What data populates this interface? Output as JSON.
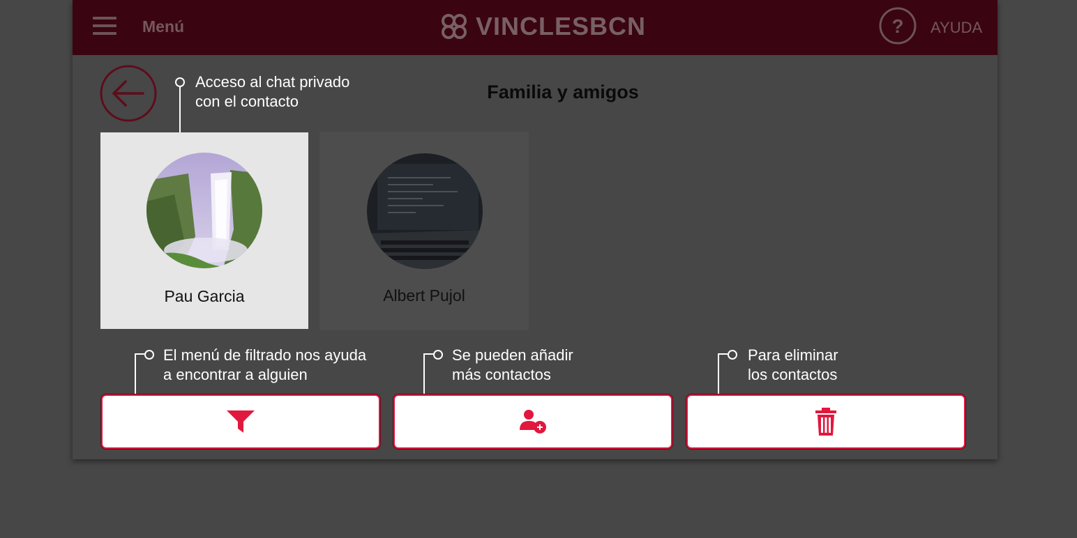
{
  "header": {
    "menu_label": "Menú",
    "logo_text": "VINCLESBCN",
    "help_label": "AYUDA"
  },
  "page": {
    "title": "Familia y amigos"
  },
  "contacts": [
    {
      "name": "Pau Garcia"
    },
    {
      "name": "Albert Pujol"
    }
  ],
  "callouts": {
    "chat": [
      "Acceso al chat privado",
      "con el contacto"
    ],
    "filter": [
      "El menú de filtrado nos ayuda",
      "a encontrar a alguien"
    ],
    "add": [
      "Se pueden añadir",
      "más contactos"
    ],
    "delete": [
      "Para eliminar",
      "los contactos"
    ]
  },
  "actions": {
    "filter_icon": "filter-icon",
    "add_icon": "add-contact-icon",
    "delete_icon": "trash-icon"
  },
  "colors": {
    "accent": "#e2173e",
    "header_bg": "#3a0510",
    "overlay_bg": "#474747"
  }
}
